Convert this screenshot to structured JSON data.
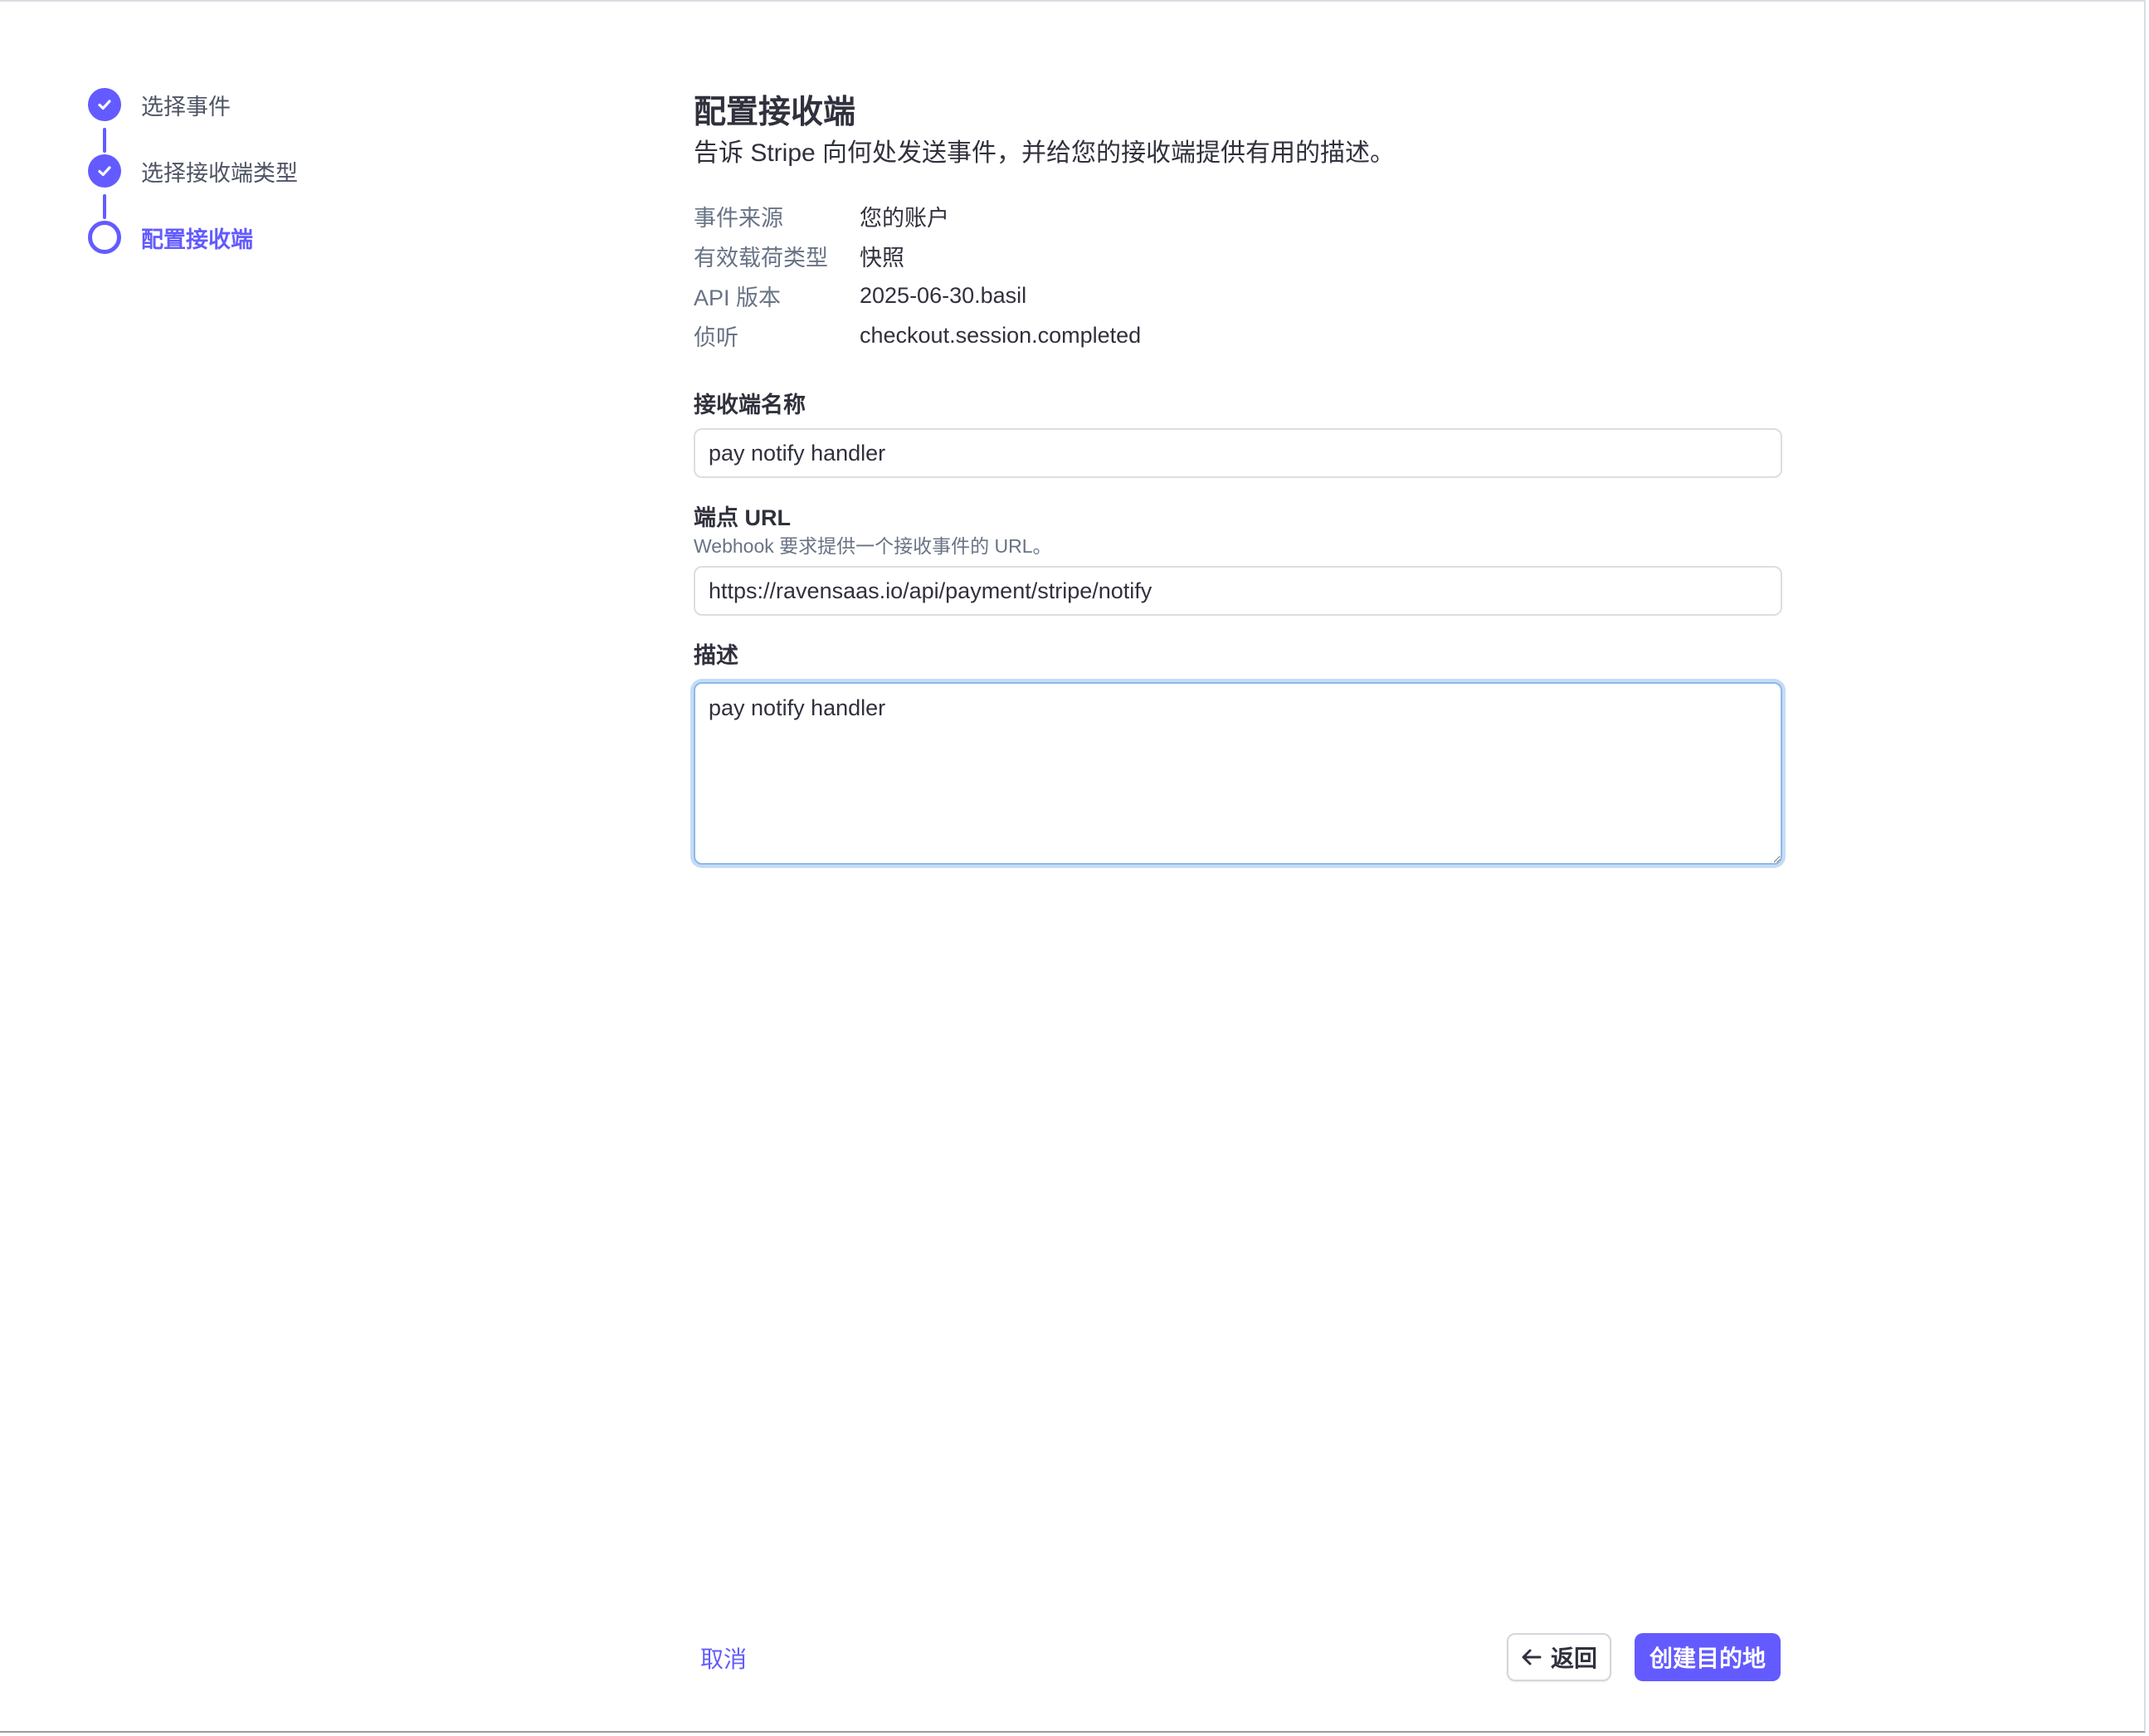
{
  "stepper": {
    "steps": [
      {
        "label": "选择事件",
        "state": "done",
        "icon": "check-icon"
      },
      {
        "label": "选择接收端类型",
        "state": "done",
        "icon": "check-icon"
      },
      {
        "label": "配置接收端",
        "state": "current",
        "icon": "ring-icon"
      }
    ]
  },
  "main": {
    "title": "配置接收端",
    "subtitle": "告诉 Stripe 向何处发送事件，并给您的接收端提供有用的描述。",
    "info": [
      {
        "key": "事件来源",
        "value": "您的账户"
      },
      {
        "key": "有效载荷类型",
        "value": "快照"
      },
      {
        "key": "API 版本",
        "value": "2025-06-30.basil"
      },
      {
        "key": "侦听",
        "value": "checkout.session.completed"
      }
    ],
    "fields": {
      "name": {
        "label": "接收端名称",
        "value": "pay notify handler"
      },
      "url": {
        "label": "端点 URL",
        "hint": "Webhook 要求提供一个接收事件的 URL。",
        "value": "https://ravensaas.io/api/payment/stripe/notify"
      },
      "description": {
        "label": "描述",
        "value": "pay notify handler"
      }
    }
  },
  "footer": {
    "cancel_label": "取消",
    "back_label": "返回",
    "create_label": "创建目的地"
  },
  "colors": {
    "accent": "#635bff",
    "focus_ring": "#c4dcf5"
  }
}
